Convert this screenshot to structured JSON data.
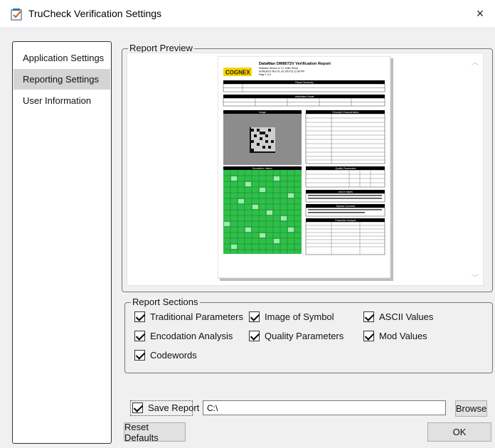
{
  "window": {
    "title": "TruCheck Verification Settings",
    "close_label": "×"
  },
  "sidebar": {
    "items": [
      {
        "label": "Application Settings",
        "selected": false
      },
      {
        "label": "Reporting Settings",
        "selected": true
      },
      {
        "label": "User Information",
        "selected": false
      }
    ]
  },
  "preview": {
    "legend": "Report Preview",
    "report": {
      "brand": "COGNEX",
      "title": "DataMan DM8072V Verification Report",
      "subtitle_lines": [
        "Software Version: 6.7.2, build: Serial",
        "Verification: Mon 01 Jul 2019 02:12:08 PM",
        "Page 1 of 1"
      ],
      "sections": [
        "Report Summary",
        "Verification Grade",
        "Image",
        "Decoded Characteristics",
        "Modulation Values",
        "Quality Parameters",
        "ASCII Values",
        "Special Comment",
        "Parameter Analysis"
      ]
    }
  },
  "report_sections": {
    "legend": "Report Sections",
    "options": [
      {
        "label": "Traditional Parameters",
        "checked": true
      },
      {
        "label": "Image of Symbol",
        "checked": true
      },
      {
        "label": "ASCII Values",
        "checked": true
      },
      {
        "label": "Encodation Analysis",
        "checked": true
      },
      {
        "label": "Quality Parameters",
        "checked": true
      },
      {
        "label": "Mod Values",
        "checked": true
      },
      {
        "label": "Codewords",
        "checked": true
      }
    ]
  },
  "save": {
    "label": "Save Report",
    "checked": true,
    "path_value": "C:\\"
  },
  "buttons": {
    "browse": "Browse",
    "reset": "Reset Defaults",
    "ok": "OK"
  },
  "colors": {
    "sidebar_selected": "#d4d4d4",
    "brand_yellow": "#f5d400",
    "modulation_green": "#2fbf4a"
  }
}
